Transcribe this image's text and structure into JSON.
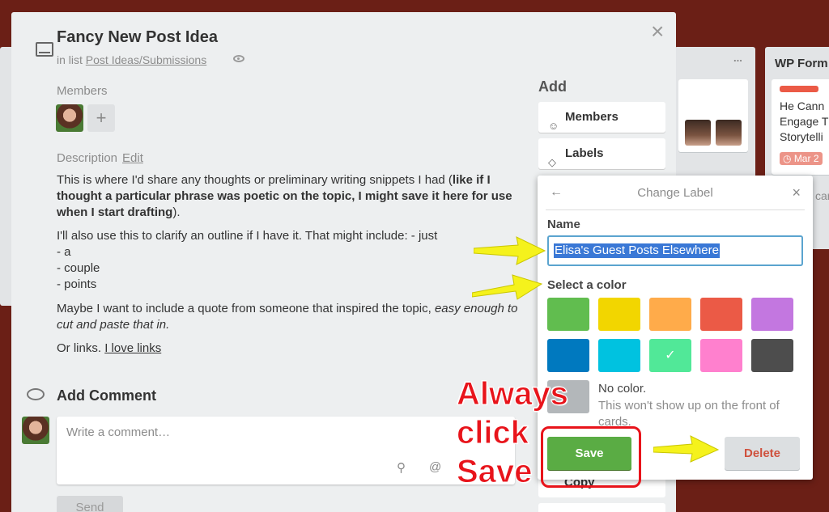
{
  "background": {
    "list_mid_menu": "...",
    "list_right_title": "WP Form",
    "right_card_text": "He Cann\nEngage T\nStorytelli",
    "right_card_due": "Mar 2",
    "right_card_tail": "car"
  },
  "card": {
    "title": "Fancy New Post Idea",
    "in_list_prefix": "in list",
    "list_name": "Post Ideas/Submissions",
    "members_label": "Members",
    "add_member_symbol": "+",
    "description_label": "Description",
    "edit_label": "Edit",
    "desc_p1_plain": "This is where I'd share any thoughts or preliminary writing snippets I had (",
    "desc_p1_bold": "like if I thought a particular phrase was poetic on the topic, I might save it here for use when I start drafting",
    "desc_p1_end": ").",
    "desc_p2": "I'll also use this to clarify an outline if I have it. That might include: - just",
    "desc_p2_lines": [
      "- a",
      "- couple",
      "- points"
    ],
    "desc_p3_plain": "Maybe I want to include a quote from someone that inspired the topic, ",
    "desc_p3_italic": "easy enough to cut and paste that in.",
    "desc_p4_plain": "Or links. ",
    "desc_p4_link": "I love links",
    "add_comment_title": "Add Comment",
    "comment_placeholder": "Write a comment…",
    "send_label": "Send"
  },
  "sidebar": {
    "add_heading": "Add",
    "members_btn": "Members",
    "labels_btn": "Labels",
    "copy_btn": "Copy"
  },
  "popover": {
    "title": "Change Label",
    "back_symbol": "←",
    "close_symbol": "×",
    "name_label": "Name",
    "name_value": "Elisa's Guest Posts Elsewhere",
    "color_label": "Select a color",
    "colors": [
      "#61bd4f",
      "#f2d600",
      "#ffab4a",
      "#eb5a46",
      "#c377e0",
      "#0079bf",
      "#00c2e0",
      "#51e898",
      "#ff80ce",
      "#4d4d4d"
    ],
    "selected_color": "#51e898",
    "no_color_title": "No color.",
    "no_color_desc": "This won't show up on the front of cards.",
    "save_label": "Save",
    "delete_label": "Delete"
  },
  "annotation": {
    "line1": "Always",
    "line2": "click",
    "line3": "Save",
    "accent": "#e8141b",
    "arrow_color": "#f5f21c"
  }
}
